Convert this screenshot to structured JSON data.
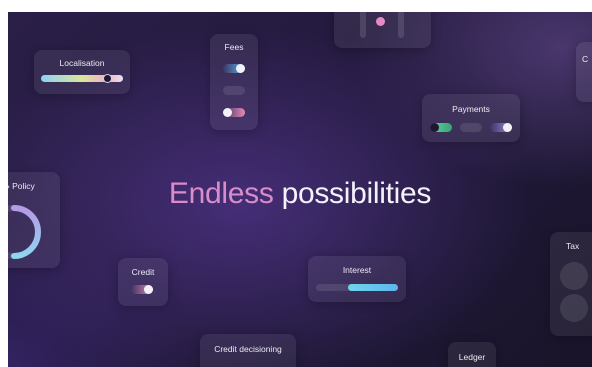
{
  "headline": {
    "accent_word": "Endless",
    "rest": " possibilities"
  },
  "cards": {
    "localisation": "Localisation",
    "fees": "Fees",
    "payments": "Payments",
    "policy": "» Policy",
    "credit": "Credit",
    "interest": "Interest",
    "tax": "Tax",
    "credit_decisioning": "Credit decisioning",
    "ledger": "Ledger",
    "top_right_partial": "C"
  },
  "colors": {
    "accent_pink": "#d98cc9",
    "blue": "#5fb4f0",
    "cyan": "#6fd6ea",
    "green": "#5ad69a",
    "purple": "#9f8be0",
    "background": "#241a3e"
  }
}
